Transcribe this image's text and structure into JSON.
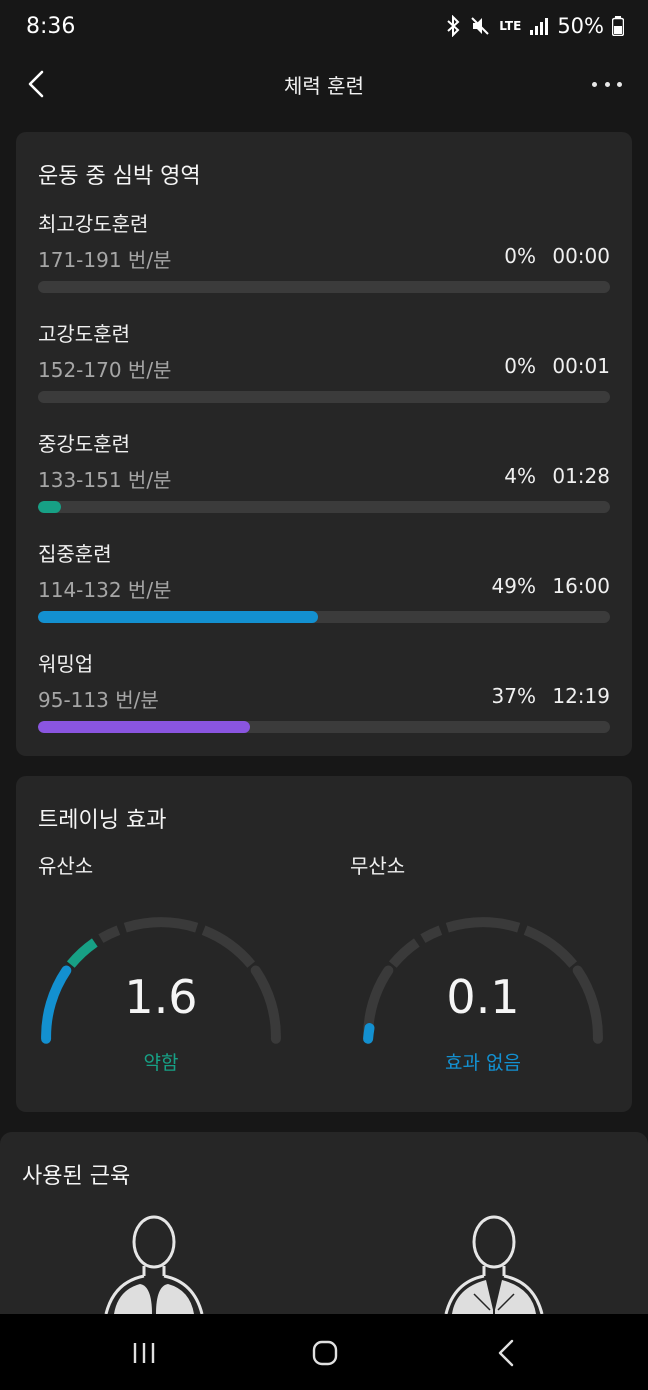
{
  "status": {
    "time": "8:36",
    "network": "LTE",
    "battery": "50%"
  },
  "header": {
    "title": "체력 훈련"
  },
  "zones_card": {
    "title": "운동 중 심박 영역",
    "zones": [
      {
        "name": "최고강도훈련",
        "range": "171-191 번/분",
        "percent": "0%",
        "time": "00:00",
        "fraction": 0,
        "color": "#e0e0e0"
      },
      {
        "name": "고강도훈련",
        "range": "152-170 번/분",
        "percent": "0%",
        "time": "00:01",
        "fraction": 0,
        "color": "#e0e0e0"
      },
      {
        "name": "중강도훈련",
        "range": "133-151 번/분",
        "percent": "4%",
        "time": "01:28",
        "fraction": 0.04,
        "color": "#17a085"
      },
      {
        "name": "집중훈련",
        "range": "114-132 번/분",
        "percent": "49%",
        "time": "16:00",
        "fraction": 0.49,
        "color": "#1390d0"
      },
      {
        "name": "워밍업",
        "range": "95-113 번/분",
        "percent": "37%",
        "time": "12:19",
        "fraction": 0.37,
        "color": "#8a55e0"
      }
    ]
  },
  "training_card": {
    "title": "트레이닝 효과",
    "aerobic": {
      "label": "유산소",
      "value": "1.6",
      "level_text": "약함",
      "level_color": "#17a085"
    },
    "anaerobic": {
      "label": "무산소",
      "value": "0.1",
      "level_text": "효과 없음",
      "level_color": "#1390d0"
    }
  },
  "muscles_card": {
    "title": "사용된 근육"
  },
  "colors": {
    "teal": "#17a085",
    "blue": "#1390d0",
    "purple": "#8a55e0",
    "card": "#262626",
    "background": "#171717"
  }
}
